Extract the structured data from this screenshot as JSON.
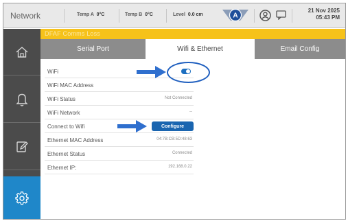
{
  "header": {
    "title": "Network",
    "readouts": [
      {
        "label": "Temp A",
        "value": "0°C"
      },
      {
        "label": "Temp B",
        "value": "0°C"
      },
      {
        "label": "Level",
        "value": "0.0 cm"
      }
    ],
    "badge_letter": "A",
    "date": "21 Nov 2025",
    "time": "05:43 PM"
  },
  "alert": {
    "text": "DFAF Comms Loss"
  },
  "sidebar": {
    "items": [
      {
        "name": "home",
        "icon": "home-icon"
      },
      {
        "name": "alarms",
        "icon": "bell-icon"
      },
      {
        "name": "notes",
        "icon": "edit-icon"
      },
      {
        "name": "settings",
        "icon": "gear-icon",
        "active": true
      }
    ]
  },
  "tabs": [
    {
      "label": "Serial Port"
    },
    {
      "label": "Wifi & Ethernet",
      "active": true
    },
    {
      "label": "Email Config"
    }
  ],
  "settings": {
    "wifi_label": "WiFi",
    "wifi_enabled": true,
    "wifi_mac_label": "WiFi MAC Address",
    "wifi_mac_value": "",
    "wifi_status_label": "WiFi Status",
    "wifi_status_value": "Not Connected",
    "wifi_network_label": "WiFi Network",
    "wifi_network_value": "--",
    "connect_label": "Connect to Wifi",
    "configure_button": "Configure",
    "eth_mac_label": "Ethernet MAC Address",
    "eth_mac_value": "04:7B:CB:5D:48:63",
    "eth_status_label": "Ethernet Status",
    "eth_status_value": "Connected",
    "eth_ip_label": "Ethernet IP:",
    "eth_ip_value": "192.168.0.22"
  },
  "colors": {
    "accent": "#1f87c9",
    "alert": "#f6c21a",
    "sidebar": "#4b4b4b",
    "button": "#1a65b0",
    "annotation": "#2f6fce"
  }
}
